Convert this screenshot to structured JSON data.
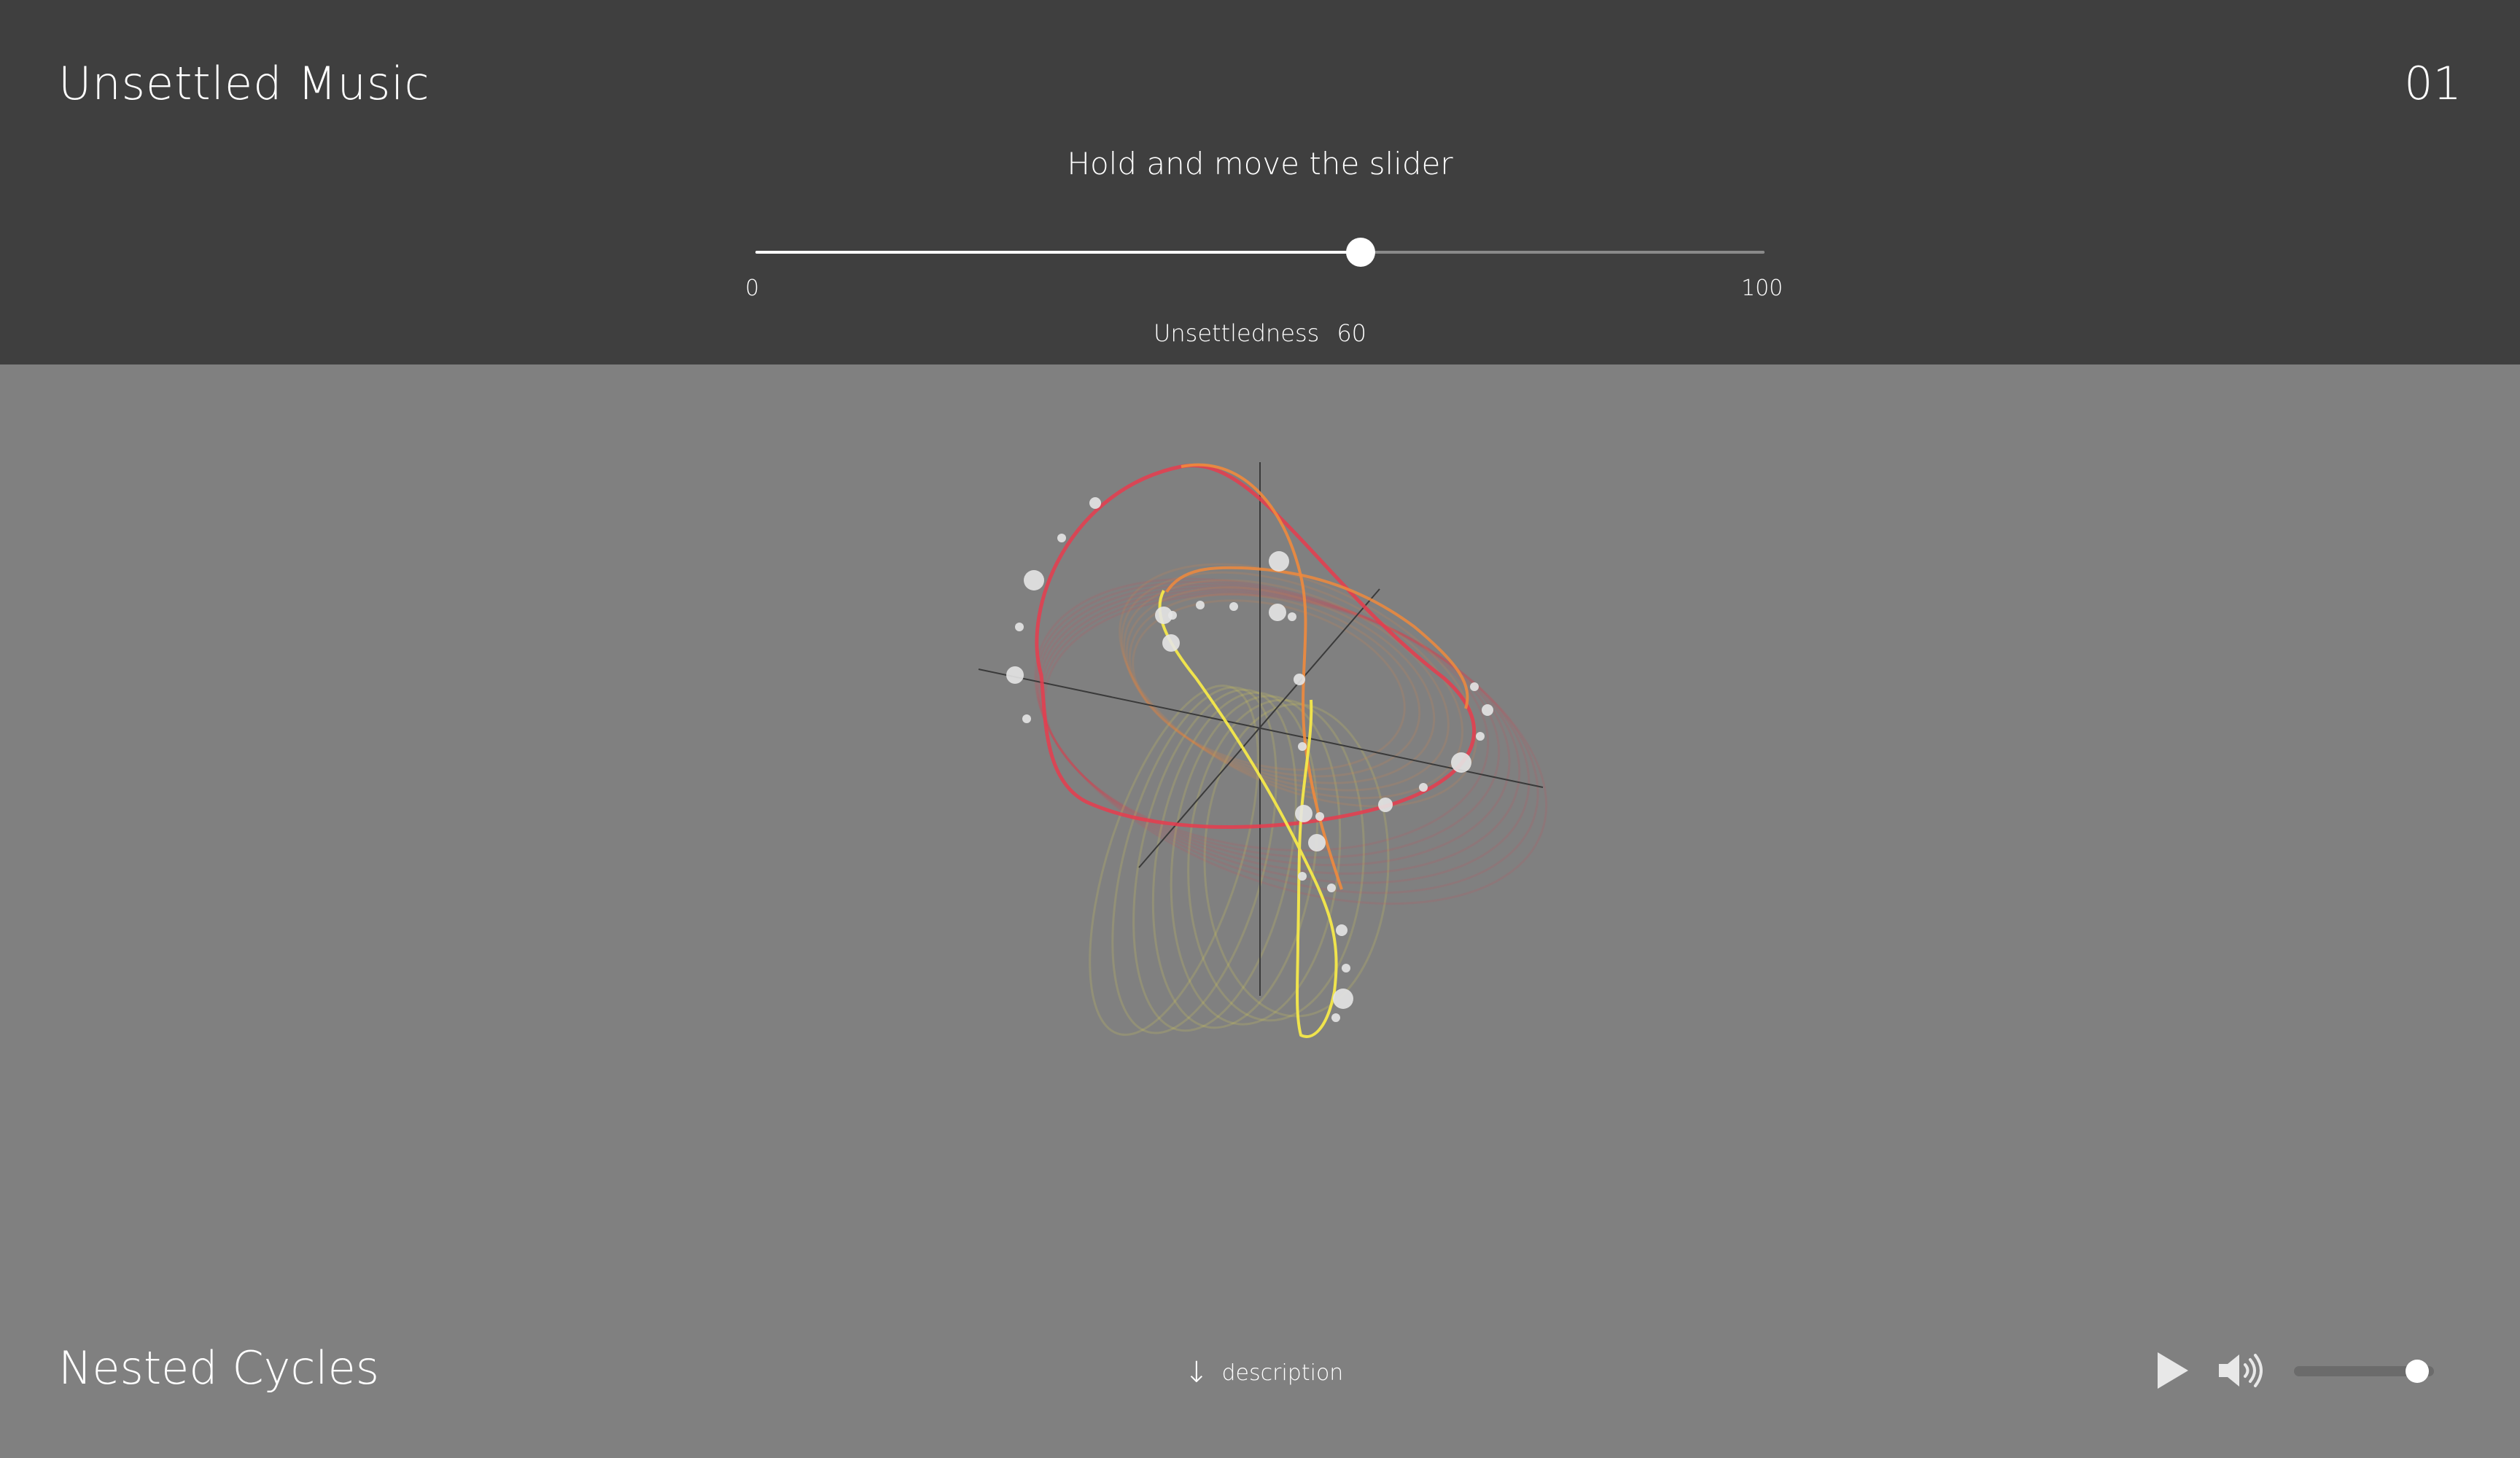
{
  "header": {
    "title": "Unsettled Music",
    "page_number": "01"
  },
  "slider": {
    "instruction": "Hold and move the slider",
    "min_label": "0",
    "max_label": "100",
    "readout_label": "Unsettledness",
    "value": 60,
    "min": 0,
    "max": 100
  },
  "visualization": {
    "description": "3D nested cycles orbit",
    "colors": {
      "outer_cycle": "#e83c4e",
      "middle_cycle": "#f08a3c",
      "inner_cycle": "#f4e84a",
      "axes": "#3a3a3a",
      "nodes": "#e4e4e4"
    }
  },
  "footer": {
    "piece_title": "Nested Cycles",
    "description_label": "description",
    "description_icon": "arrow-down-icon"
  },
  "player": {
    "play_icon": "play-icon",
    "volume_icon": "volume-icon",
    "volume_level": 0.88
  },
  "colors": {
    "header_bg": "#3f3f3f",
    "page_bg": "#808080",
    "text": "#ffffff"
  }
}
